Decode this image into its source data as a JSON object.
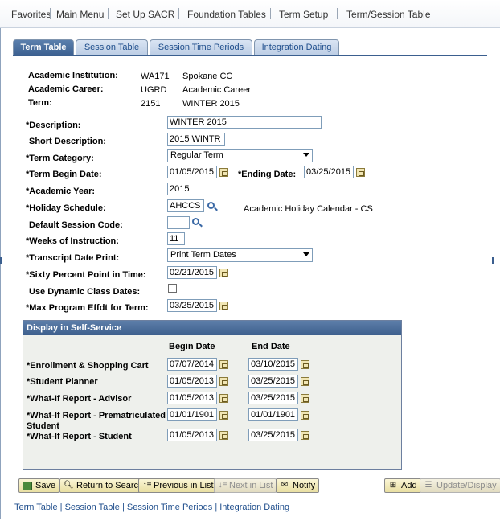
{
  "breadcrumb": {
    "favorites": "Favorites",
    "main_menu": "Main Menu",
    "setup_sacr": "Set Up SACR",
    "foundation_tables": "Foundation Tables",
    "term_setup": "Term Setup",
    "current": "Term/Session Table"
  },
  "tabs": [
    {
      "label": "Term Table",
      "active": true
    },
    {
      "label": "Session Table",
      "active": false
    },
    {
      "label": "Session Time Periods",
      "active": false
    },
    {
      "label": "Integration Dating",
      "active": false
    }
  ],
  "header": {
    "institution_label": "Academic Institution:",
    "institution_code": "WA171",
    "institution_name": "Spokane CC",
    "career_label": "Academic Career:",
    "career_code": "UGRD",
    "career_name": "Academic Career",
    "term_label": "Term:",
    "term_code": "2151",
    "term_name": "WINTER 2015"
  },
  "form": {
    "description_label": "*Description:",
    "description_value": "WINTER 2015",
    "short_description_label": "Short Description:",
    "short_description_value": "2015 WINTR",
    "term_category_label": "*Term Category:",
    "term_category_value": "Regular Term",
    "term_begin_label": "*Term Begin Date:",
    "term_begin_value": "01/05/2015",
    "ending_date_label": "*Ending Date:",
    "ending_date_value": "03/25/2015",
    "academic_year_label": "*Academic Year:",
    "academic_year_value": "2015",
    "holiday_schedule_label": "*Holiday Schedule:",
    "holiday_schedule_value": "AHCCS",
    "holiday_schedule_desc": "Academic Holiday Calendar - CS",
    "default_session_label": "Default Session Code:",
    "default_session_value": "",
    "weeks_label": "*Weeks of Instruction:",
    "weeks_value": "11",
    "transcript_label": "*Transcript Date Print:",
    "transcript_value": "Print Term Dates",
    "sixty_label": "*Sixty Percent Point in Time:",
    "sixty_value": "02/21/2015",
    "dynamic_label": "Use Dynamic Class Dates:",
    "dynamic_checked": false,
    "max_program_label": "*Max Program Effdt for Term:",
    "max_program_value": "03/25/2015"
  },
  "self_service": {
    "title": "Display in Self-Service",
    "begin_header": "Begin Date",
    "end_header": "End Date",
    "rows": [
      {
        "label": "*Enrollment & Shopping Cart",
        "begin": "07/07/2014",
        "end": "03/10/2015"
      },
      {
        "label": "*Student Planner",
        "begin": "01/05/2013",
        "end": "03/25/2015"
      },
      {
        "label": "*What-If Report - Advisor",
        "begin": "01/05/2013",
        "end": "03/25/2015"
      },
      {
        "label": "*What-If Report - Prematriculated",
        "label2": "Student",
        "begin": "01/01/1901",
        "end": "01/01/1901"
      },
      {
        "label": "*What-If Report - Student",
        "begin": "01/05/2013",
        "end": "03/25/2015"
      }
    ]
  },
  "toolbar": {
    "save": "Save",
    "return_search": "Return to Search",
    "previous": "Previous in List",
    "next": "Next in List",
    "notify": "Notify",
    "add": "Add",
    "update_display": "Update/Display"
  },
  "bottom_links": {
    "term_table": "Term Table",
    "session_table": "Session Table",
    "session_time_periods": "Session Time Periods",
    "integration_dating": "Integration Dating",
    "separator": "|"
  }
}
